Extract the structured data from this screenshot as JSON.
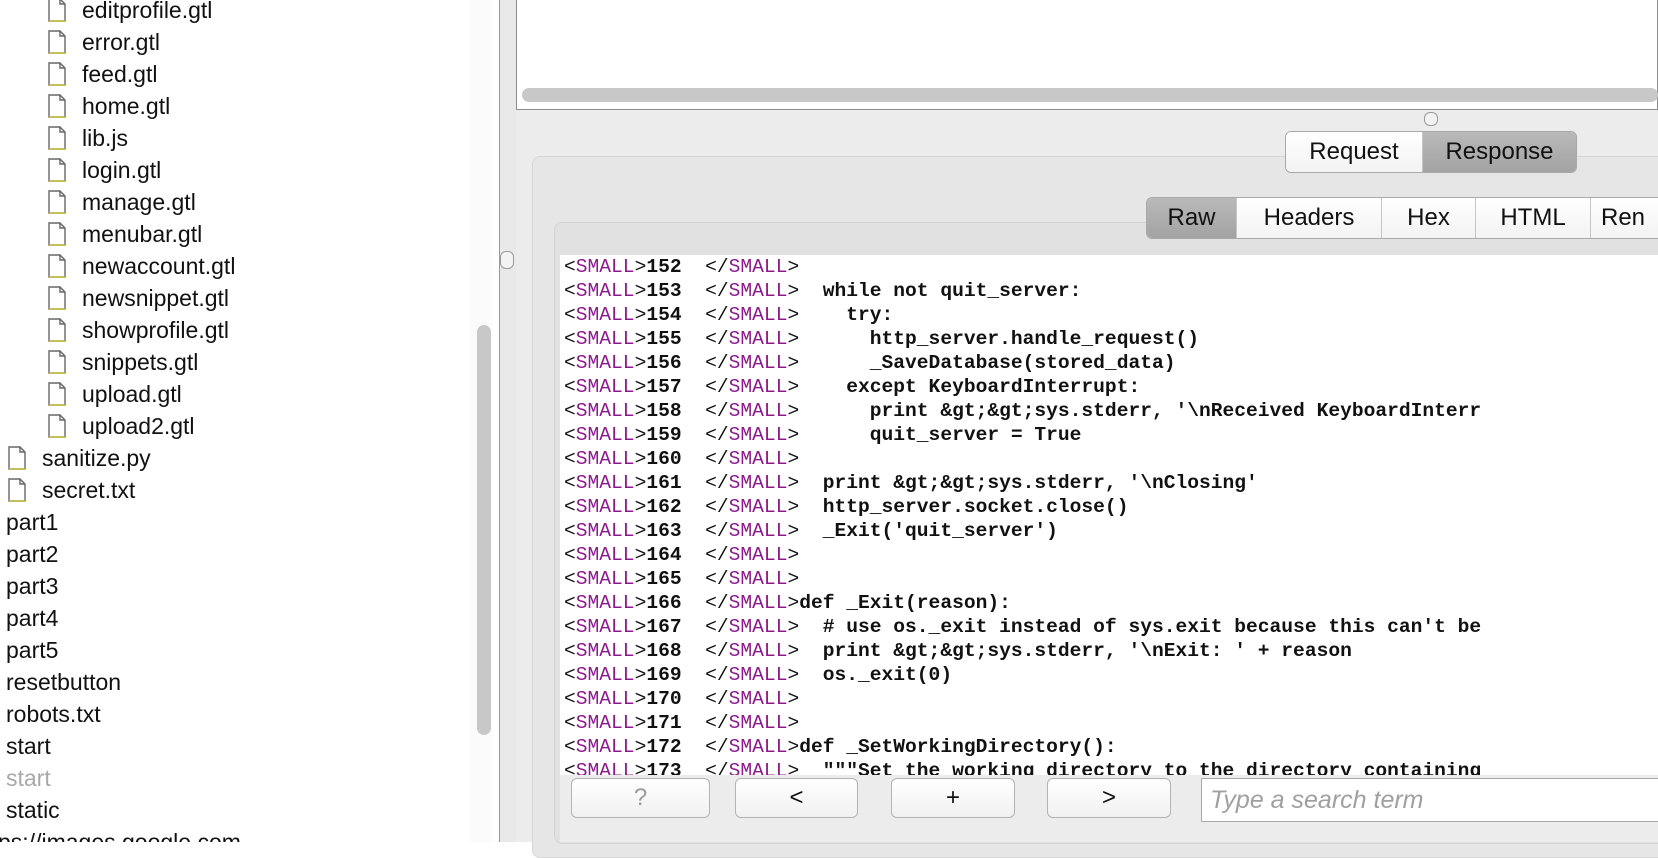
{
  "tree": {
    "nested_files": [
      "editprofile.gtl",
      "error.gtl",
      "feed.gtl",
      "home.gtl",
      "lib.js",
      "login.gtl",
      "manage.gtl",
      "menubar.gtl",
      "newaccount.gtl",
      "newsnippet.gtl",
      "showprofile.gtl",
      "snippets.gtl",
      "upload.gtl",
      "upload2.gtl"
    ],
    "files": [
      "sanitize.py",
      "secret.txt"
    ],
    "entries": [
      "part1",
      "part2",
      "part3",
      "part4",
      "part5",
      "resetbutton",
      "robots.txt",
      "start"
    ],
    "dim_entry": "start",
    "last_entry": "static",
    "cut_entry": "ps://images.google.com"
  },
  "view_toggle": {
    "request_label": "Request",
    "response_label": "Response",
    "active": "Response"
  },
  "response_tabs": {
    "tabs": [
      "Raw",
      "Headers",
      "Hex",
      "HTML",
      "Ren"
    ],
    "active": "Raw"
  },
  "code": {
    "open_tag": "SMALL",
    "lines": [
      {
        "n": "152",
        "src": ""
      },
      {
        "n": "153",
        "src": "  while not quit_server:"
      },
      {
        "n": "154",
        "src": "    try:"
      },
      {
        "n": "155",
        "src": "      http_server.handle_request()"
      },
      {
        "n": "156",
        "src": "      _SaveDatabase(stored_data)"
      },
      {
        "n": "157",
        "src": "    except KeyboardInterrupt:"
      },
      {
        "n": "158",
        "src": "      print &gt;&gt;sys.stderr, '\\nReceived KeyboardInterr"
      },
      {
        "n": "159",
        "src": "      quit_server = True"
      },
      {
        "n": "160",
        "src": ""
      },
      {
        "n": "161",
        "src": "  print &gt;&gt;sys.stderr, '\\nClosing'"
      },
      {
        "n": "162",
        "src": "  http_server.socket.close()"
      },
      {
        "n": "163",
        "src": "  _Exit('quit_server')"
      },
      {
        "n": "164",
        "src": ""
      },
      {
        "n": "165",
        "src": ""
      },
      {
        "n": "166",
        "src": "def _Exit(reason):"
      },
      {
        "n": "167",
        "src": "  # use os._exit instead of sys.exit because this can't be"
      },
      {
        "n": "168",
        "src": "  print &gt;&gt;sys.stderr, '\\nExit: ' + reason"
      },
      {
        "n": "169",
        "src": "  os._exit(0)"
      },
      {
        "n": "170",
        "src": ""
      },
      {
        "n": "171",
        "src": ""
      },
      {
        "n": "172",
        "src": "def _SetWorkingDirectory():"
      },
      {
        "n": "173",
        "src": "  \"\"\"Set the working directory to the directory containing"
      }
    ]
  },
  "bottom_bar": {
    "help_label": "?",
    "prev_label": "<",
    "add_label": "+",
    "next_label": ">",
    "search_placeholder": "Type a search term"
  },
  "colors": {
    "tag": "#8c1a8c",
    "active_tab": "#a9a9a9",
    "panel_bg": "#ececec"
  },
  "icons": {
    "file": "file-icon"
  }
}
